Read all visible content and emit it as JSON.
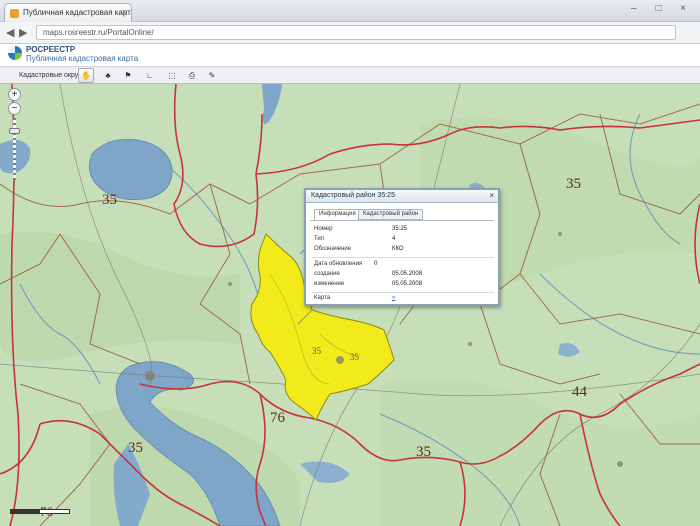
{
  "browser": {
    "tab_title": "Публичная кадастровая карта",
    "tab_close": "×",
    "window_controls": "– □ ×",
    "back": "◀",
    "forward": "▶",
    "url": "maps.rosreestr.ru/PortalOnline/"
  },
  "app": {
    "brand_line1": "РОСРЕЕСТР",
    "brand_line2": "Публичная кадастровая карта"
  },
  "toolbar": {
    "layers_select": "Кадастровые округа ▾",
    "buttons": [
      {
        "icon": "pan-hand-icon",
        "glyph": "✋"
      },
      {
        "icon": "tree-icon",
        "glyph": "♣"
      },
      {
        "icon": "identify-icon",
        "glyph": "⚑"
      },
      {
        "icon": "measure-icon",
        "glyph": "∟"
      },
      {
        "icon": "selection-icon",
        "glyph": "⬚"
      },
      {
        "icon": "print-icon",
        "glyph": "⎙"
      },
      {
        "icon": "settings-icon",
        "glyph": "✎"
      }
    ]
  },
  "map": {
    "labels": [
      {
        "text": "35"
      },
      {
        "text": "35"
      },
      {
        "text": "35"
      },
      {
        "text": "35"
      },
      {
        "text": "35"
      },
      {
        "text": "35"
      },
      {
        "text": "44"
      },
      {
        "text": "76"
      },
      {
        "text": "76"
      }
    ],
    "zoom_in": "+",
    "zoom_out": "−",
    "colors": {
      "land": "#c7dfb9",
      "water": "#7fa6c8",
      "region_border": "#c8323a",
      "highlight": "#f2ea1a"
    }
  },
  "popup": {
    "title": "Кадастровый район 35:25",
    "close": "×",
    "tabs": [
      "Информация",
      "Кадастровый район"
    ],
    "rows": [
      {
        "key": "Номер",
        "value": "35:25"
      },
      {
        "key": "Тип",
        "value": "4"
      },
      {
        "key": "Обозначение",
        "value": "ККО"
      },
      {
        "key": "Дата обновления",
        "value": "0"
      },
      {
        "key": "создание",
        "value": "05.05.2008"
      },
      {
        "key": "изменение",
        "value": "05.05.2008"
      },
      {
        "key": "Карта",
        "value": "»"
      }
    ]
  }
}
